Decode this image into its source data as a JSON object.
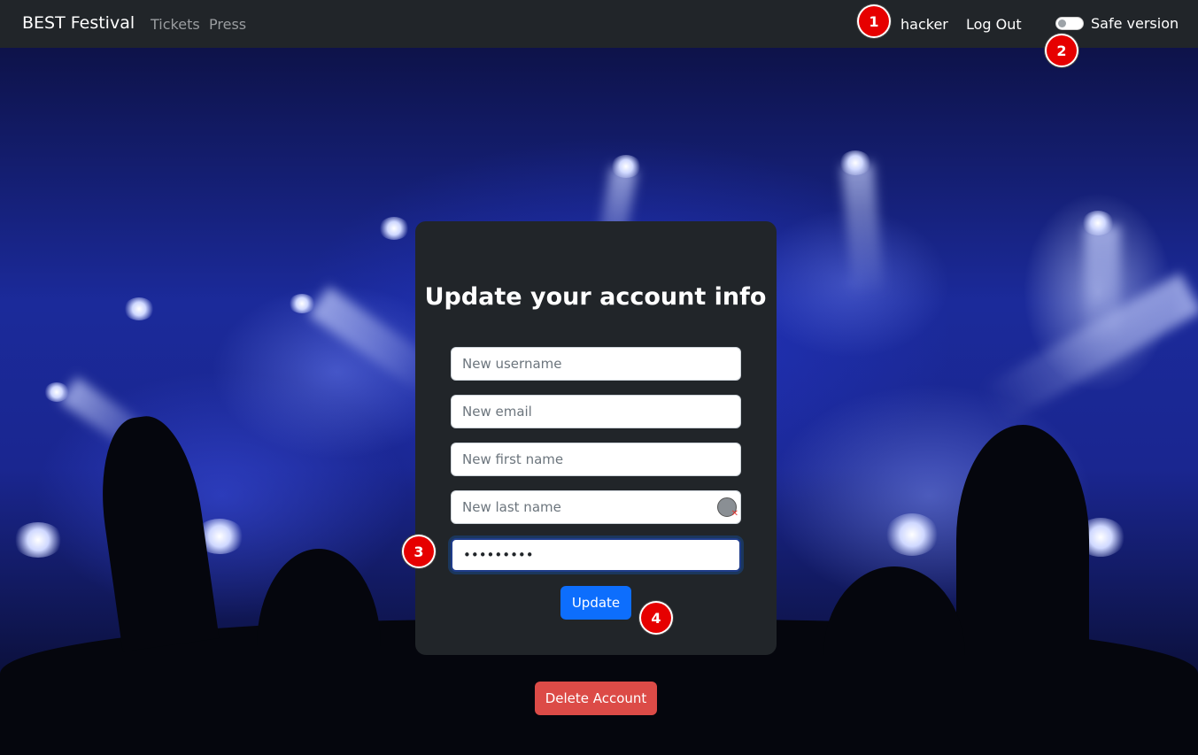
{
  "navbar": {
    "brand": "BEST Festival",
    "links": [
      "Tickets",
      "Press"
    ],
    "user": "hacker",
    "logout": "Log Out",
    "safe_toggle_label": "Safe version",
    "safe_toggle_on": false
  },
  "form": {
    "title": "Update your account info",
    "username_placeholder": "New username",
    "email_placeholder": "New email",
    "first_name_placeholder": "New first name",
    "last_name_placeholder": "New last name",
    "password_value": "•••••••••",
    "update_label": "Update"
  },
  "delete_label": "Delete Account",
  "annotations": [
    "1",
    "2",
    "3",
    "4"
  ],
  "colors": {
    "navbar": "#212529",
    "card": "#212529",
    "primary_button": "#0d6efd",
    "danger_button": "#dc4b47",
    "badge": "#e60000"
  },
  "icons": {
    "field_autofill": "password-manager-icon"
  }
}
